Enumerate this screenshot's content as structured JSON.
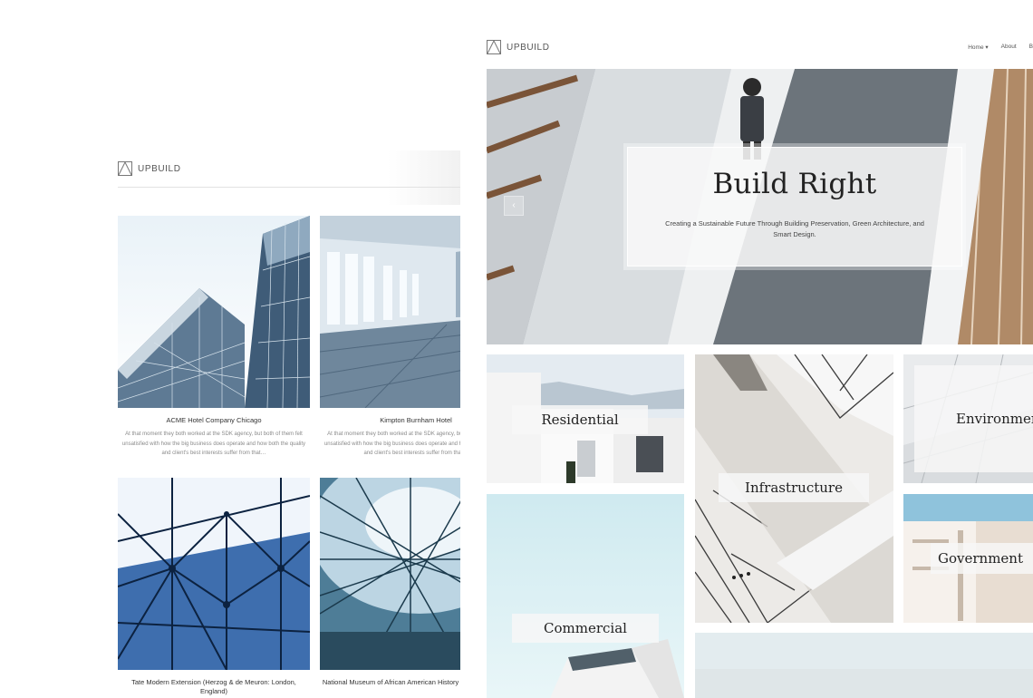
{
  "brand": {
    "name": "UPBUILD"
  },
  "back_page": {
    "cards": [
      {
        "title": "ACME Hotel Company Chicago",
        "description": "At that moment they both worked at the SDK agency, but both of them felt unsatisfied with how the big business does operate and how both the quality and client's best interests suffer from that…"
      },
      {
        "title": "Kimpton Burnham Hotel",
        "description": "At that moment they both worked at the SDK agency, but both of them felt unsatisfied with how the big business does operate and how both the quality and client's best interests suffer from that…"
      },
      {
        "title": "Tate Modern Extension (Herzog & de Meuron: London, England)"
      },
      {
        "title": "National Museum of African American History (David Adjaye…"
      }
    ]
  },
  "front_page": {
    "nav": {
      "home": "Home ▾",
      "about": "About",
      "more": "B"
    },
    "hero": {
      "title": "Build Right",
      "subtitle": "Creating a Sustainable Future Through Building Preservation, Green Architecture, and Smart Design.",
      "prev_arrow": "‹"
    },
    "tiles": {
      "residential": "Residential",
      "infrastructure": "Infrastructure",
      "environment": "Environment",
      "government": "Government",
      "commercial": "Commercial"
    }
  }
}
